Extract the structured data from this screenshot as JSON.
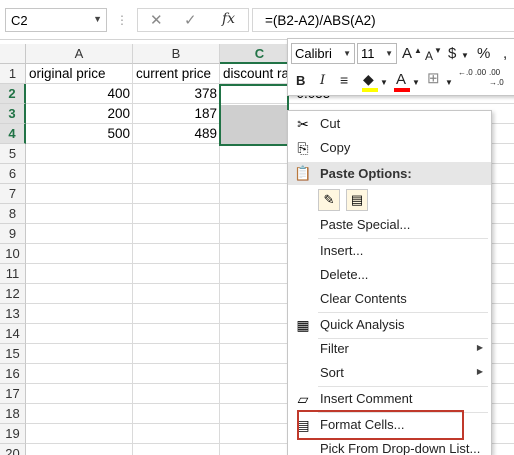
{
  "formula_bar": {
    "name_box": "C2",
    "cancel_glyph": "✕",
    "enter_glyph": "✓",
    "fx_label": "fx",
    "formula": "=(B2-A2)/ABS(A2)"
  },
  "columns": [
    "A",
    "B",
    "C"
  ],
  "rows": [
    "1",
    "2",
    "3",
    "4",
    "5",
    "6",
    "7",
    "8",
    "9",
    "10",
    "11",
    "12",
    "13",
    "14",
    "15",
    "16",
    "17",
    "18",
    "19",
    "20"
  ],
  "cells": {
    "A1": "original price",
    "B1": "current price",
    "C1": "discount ra",
    "A2": "400",
    "B2": "378",
    "C2": "-0.055",
    "A3": "200",
    "B3": "187",
    "A4": "500",
    "B4": "489"
  },
  "mini_toolbar": {
    "font_name": "Calibri",
    "font_size": "11",
    "grow_label": "A",
    "shrink_label": "A",
    "currency": "$",
    "percent": "%",
    "bold": "B",
    "italic": "I",
    "font_color_label": "A",
    "inc_decimal": "←.0 .00",
    "dec_decimal": ".00 →.0"
  },
  "context_menu": {
    "cut": "Cut",
    "copy": "Copy",
    "paste_options": "Paste Options:",
    "paste_special": "Paste Special...",
    "insert": "Insert...",
    "delete": "Delete...",
    "clear_contents": "Clear Contents",
    "quick_analysis": "Quick Analysis",
    "filter": "Filter",
    "sort": "Sort",
    "insert_comment": "Insert Comment",
    "format_cells": "Format Cells...",
    "pick_from_list": "Pick From Drop-down List..."
  },
  "icons": {
    "cut": "scissors-icon",
    "copy": "copy-icon",
    "paste": "clipboard-icon",
    "quick_analysis": "quick-analysis-icon",
    "comment": "comment-icon",
    "format_cells": "format-cells-icon"
  },
  "colors": {
    "excel_green": "#217346",
    "highlight_red": "#c0392b",
    "fill_yellow": "#ffff00",
    "font_red": "#ff0000"
  }
}
